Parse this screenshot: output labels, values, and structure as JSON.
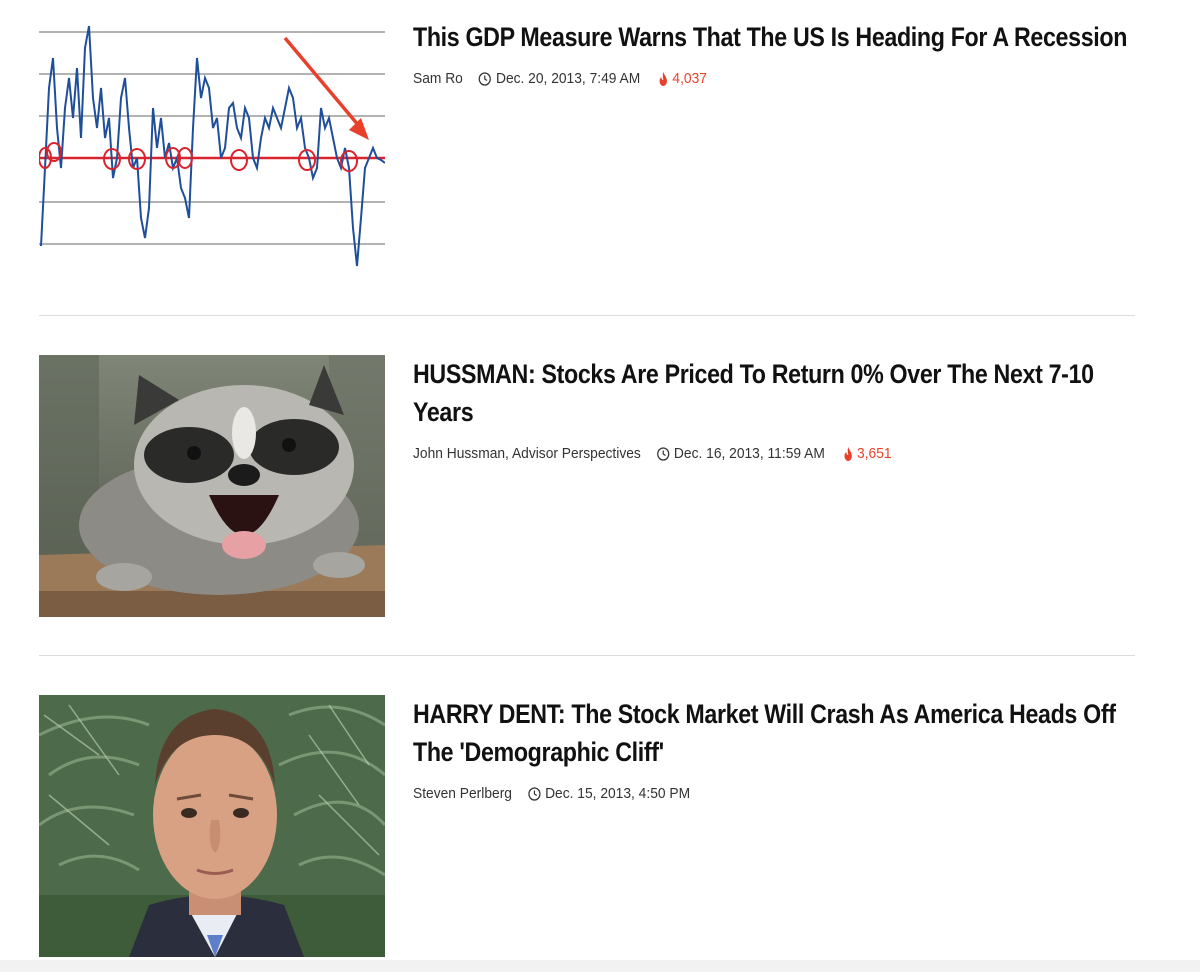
{
  "articles": [
    {
      "headline": "This GDP Measure Warns That The US Is Heading For A Recession",
      "author": "Sam Ro",
      "date": "Dec. 20, 2013, 7:49 AM",
      "views": "4,037",
      "thumbnail": "gdp-chart-thumbnail"
    },
    {
      "headline": "HUSSMAN: Stocks Are Priced To Return 0% Over The Next 7-10 Years",
      "author": "John Hussman, Advisor Perspectives",
      "date": "Dec. 16, 2013, 11:59 AM",
      "views": "3,651",
      "thumbnail": "raccoon-photo-thumbnail"
    },
    {
      "headline": "HARRY DENT: The Stock Market Will Crash As America Heads Off The 'Demographic Cliff'",
      "author": "Steven Perlberg",
      "date": "Dec. 15, 2013, 4:50 PM",
      "thumbnail": "harry-dent-photo-thumbnail"
    }
  ],
  "colors": {
    "accent_views": "#e8412b",
    "divider": "#dcdcdc",
    "chart_line": "#1f4e9a",
    "chart_threshold": "#d9232e"
  },
  "icons": {
    "clock": "clock-icon",
    "views": "flame-icon"
  }
}
